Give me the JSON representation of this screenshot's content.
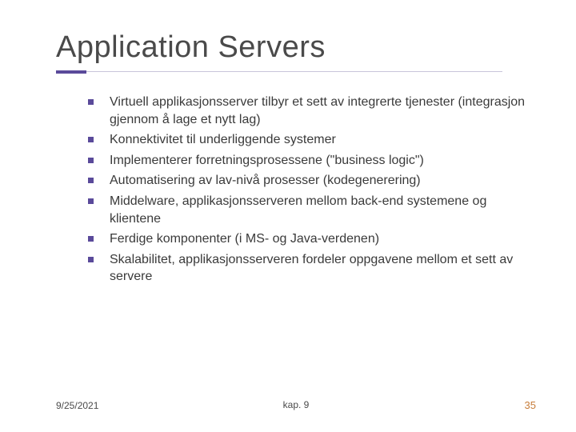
{
  "title": "Application Servers",
  "bullets": [
    "Virtuell applikasjonsserver tilbyr et sett av integrerte tjenester (integrasjon gjennom å lage et nytt lag)",
    "Konnektivitet til underliggende systemer",
    "Implementerer forretningsprosessene (\"business logic\")",
    "Automatisering av lav-nivå prosesser (kodegenerering)",
    "Middelware, applikasjonsserveren mellom back-end systemene og klientene",
    "Ferdige komponenter (i MS- og Java-verdenen)",
    "Skalabilitet, applikasjonsserveren fordeler oppgavene mellom et sett av servere"
  ],
  "footer": {
    "date": "9/25/2021",
    "chapter": "kap. 9",
    "page": "35"
  }
}
